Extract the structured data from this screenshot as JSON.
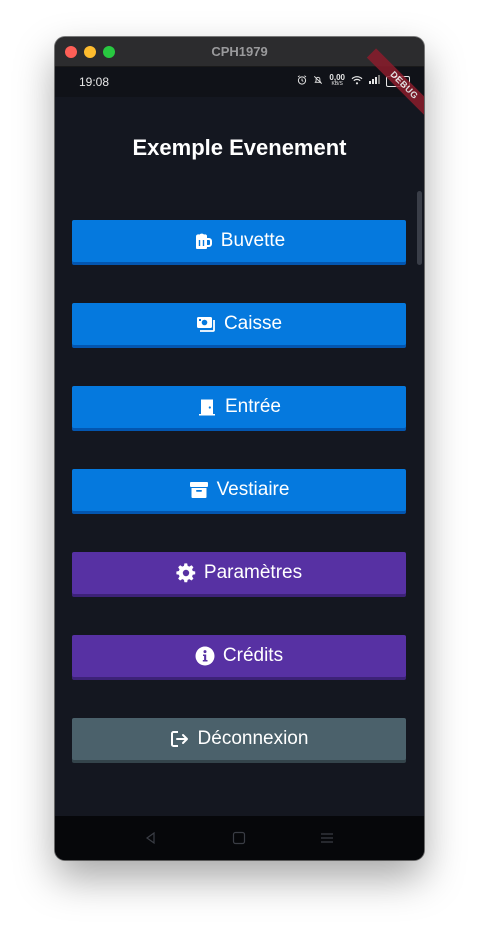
{
  "window": {
    "title": "CPH1979"
  },
  "status_bar": {
    "time": "19:08",
    "net_speed": "0,00",
    "net_unit": "KB/S",
    "battery": "56",
    "debug_banner": "DEBUG"
  },
  "app": {
    "title": "Exemple Evenement"
  },
  "buttons": [
    {
      "label": "Buvette",
      "icon": "beer-mug-icon",
      "color": "#0579de",
      "shadow": "#0356b0"
    },
    {
      "label": "Caisse",
      "icon": "cash-register-icon",
      "color": "#0579de",
      "shadow": "#0356b0"
    },
    {
      "label": "Entrée",
      "icon": "door-icon",
      "color": "#0579de",
      "shadow": "#0356b0"
    },
    {
      "label": "Vestiaire",
      "icon": "archive-box-icon",
      "color": "#0579de",
      "shadow": "#0356b0"
    },
    {
      "label": "Paramètres",
      "icon": "gear-icon",
      "color": "#5731a3",
      "shadow": "#3d2278"
    },
    {
      "label": "Crédits",
      "icon": "info-icon",
      "color": "#5731a3",
      "shadow": "#3d2278"
    },
    {
      "label": "Déconnexion",
      "icon": "logout-icon",
      "color": "#4b616b",
      "shadow": "#34444b"
    }
  ],
  "nav": {
    "back": "back-icon",
    "home": "home-icon",
    "menu": "menu-icon"
  }
}
